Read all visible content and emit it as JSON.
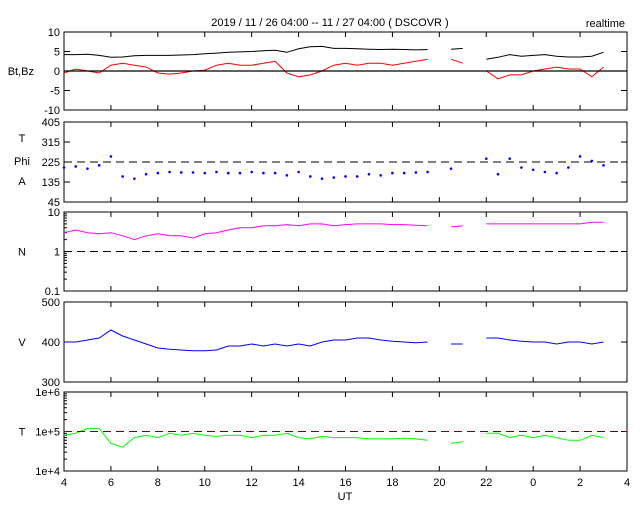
{
  "header": {
    "title": "2019 / 11 / 26   04:00 -- 11 / 27   04:00 ( DSCOVR )",
    "mode": "realtime"
  },
  "chart_data": {
    "type": "line",
    "title": "2019 / 11 / 26   04:00 -- 11 / 27   04:00 ( DSCOVR )",
    "xlabel": "UT",
    "x_tick_labels": [
      "4",
      "6",
      "8",
      "10",
      "12",
      "14",
      "16",
      "18",
      "20",
      "22",
      "0",
      "2",
      "4"
    ],
    "x_range_hours": [
      0,
      24
    ],
    "sample_step_hours": 0.5,
    "panels": [
      {
        "id": "mag",
        "ylabel": "Bt,Bz",
        "scale": "linear",
        "ylim": [
          -10,
          10
        ],
        "ticks": [
          10,
          5,
          0,
          -5,
          -10
        ],
        "tick_labels": [
          "10",
          "5",
          "0",
          "-5",
          "-10"
        ],
        "ref_line": {
          "value": 0,
          "style": "solid",
          "color": "#000000"
        },
        "series": [
          {
            "name": "Bt",
            "color": "#000000",
            "values": [
              4.2,
              4.2,
              4.3,
              4.0,
              3.5,
              3.6,
              3.9,
              4.0,
              4.0,
              4.0,
              4.1,
              4.2,
              4.4,
              4.6,
              4.8,
              4.9,
              5.0,
              5.2,
              5.3,
              4.8,
              5.7,
              6.2,
              6.3,
              5.8,
              5.8,
              5.7,
              5.6,
              5.5,
              5.6,
              5.5,
              5.4,
              5.5,
              null,
              5.6,
              5.8,
              null,
              3.0,
              3.5,
              4.2,
              3.8,
              4.0,
              4.2,
              3.8,
              3.6,
              3.6,
              3.8,
              4.8,
              null,
              null
            ]
          },
          {
            "name": "Bz",
            "color": "#ff0000",
            "values": [
              -0.5,
              0.5,
              0,
              -0.5,
              1.5,
              2,
              1.5,
              1,
              -0.5,
              -0.8,
              -0.5,
              0,
              0.2,
              1.5,
              2,
              1.5,
              1.5,
              2,
              2.5,
              -0.5,
              -1.5,
              -1,
              0,
              1.5,
              2,
              1.5,
              2,
              2,
              1.5,
              2,
              2.5,
              3,
              null,
              3,
              2,
              null,
              0,
              -2,
              -1,
              -1,
              0,
              0.5,
              1,
              0.5,
              0.5,
              -1.5,
              1,
              null,
              null
            ]
          }
        ]
      },
      {
        "id": "phi",
        "ylabel_lines": [
          "T",
          "Phi",
          "A"
        ],
        "scale": "linear",
        "ylim": [
          45,
          405
        ],
        "ticks": [
          405,
          315,
          225,
          135,
          45
        ],
        "tick_labels": [
          "405",
          "315",
          "225",
          "135",
          "45"
        ],
        "ref_line": {
          "value": 225,
          "style": "dashed",
          "color": "#000000"
        },
        "series": [
          {
            "name": "Phi",
            "color": "#0000ff",
            "style": "dots",
            "values": [
              200,
              205,
              195,
              210,
              250,
              160,
              150,
              170,
              175,
              180,
              178,
              178,
              175,
              180,
              175,
              175,
              180,
              175,
              175,
              165,
              180,
              160,
              150,
              155,
              160,
              160,
              170,
              165,
              175,
              175,
              178,
              180,
              null,
              195,
              null,
              null,
              240,
              170,
              240,
              200,
              190,
              180,
              175,
              200,
              250,
              230,
              210,
              null,
              null
            ]
          }
        ]
      },
      {
        "id": "density",
        "ylabel": "N",
        "scale": "log",
        "ylim": [
          0.1,
          10
        ],
        "ticks": [
          10,
          1,
          0.1
        ],
        "tick_labels": [
          "10",
          "1",
          "0.1"
        ],
        "ref_line": {
          "value": 1,
          "style": "dashed",
          "color": "#000000"
        },
        "series": [
          {
            "name": "N",
            "color": "#ff00ff",
            "values": [
              3,
              3.5,
              3,
              2.8,
              3,
              2.5,
              2,
              2.5,
              2.8,
              2.5,
              2.5,
              2.2,
              2.8,
              3,
              3.5,
              4,
              4,
              4.5,
              4.5,
              4.8,
              4.5,
              5,
              5,
              4.5,
              4.8,
              5,
              5,
              5,
              4.8,
              4.8,
              4.6,
              4.5,
              null,
              4.2,
              4.5,
              null,
              5,
              5,
              5,
              5,
              5,
              5,
              5,
              5,
              5,
              5.5,
              5.5,
              null,
              null
            ]
          }
        ]
      },
      {
        "id": "speed",
        "ylabel": "V",
        "scale": "linear",
        "ylim": [
          300,
          500
        ],
        "ticks": [
          500,
          400,
          300
        ],
        "tick_labels": [
          "500",
          "400",
          "300"
        ],
        "series": [
          {
            "name": "V",
            "color": "#0000ff",
            "values": [
              400,
              400,
              405,
              410,
              430,
              415,
              405,
              395,
              385,
              382,
              380,
              378,
              378,
              380,
              390,
              390,
              395,
              390,
              395,
              390,
              395,
              390,
              400,
              405,
              405,
              410,
              410,
              405,
              402,
              400,
              398,
              400,
              null,
              395,
              395,
              null,
              410,
              410,
              405,
              402,
              400,
              400,
              395,
              400,
              400,
              395,
              400,
              null,
              null
            ]
          }
        ]
      },
      {
        "id": "temperature",
        "ylabel": "T",
        "scale": "log",
        "ylim": [
          10000,
          1000000
        ],
        "ticks": [
          1000000,
          100000,
          10000
        ],
        "tick_labels": [
          "1e+6",
          "1e+5",
          "1e+4"
        ],
        "ref_line": {
          "value": 100000,
          "style": "dashed",
          "color": "#800000"
        },
        "series": [
          {
            "name": "T",
            "color": "#00ff00",
            "values": [
              80000,
              90000,
              120000,
              120000,
              50000,
              40000,
              70000,
              80000,
              70000,
              90000,
              80000,
              90000,
              80000,
              75000,
              80000,
              80000,
              70000,
              80000,
              80000,
              90000,
              70000,
              65000,
              75000,
              70000,
              70000,
              70000,
              65000,
              65000,
              65000,
              68000,
              65000,
              60000,
              null,
              50000,
              55000,
              null,
              90000,
              90000,
              70000,
              80000,
              70000,
              80000,
              70000,
              60000,
              60000,
              80000,
              70000,
              null,
              null
            ]
          }
        ]
      }
    ]
  }
}
